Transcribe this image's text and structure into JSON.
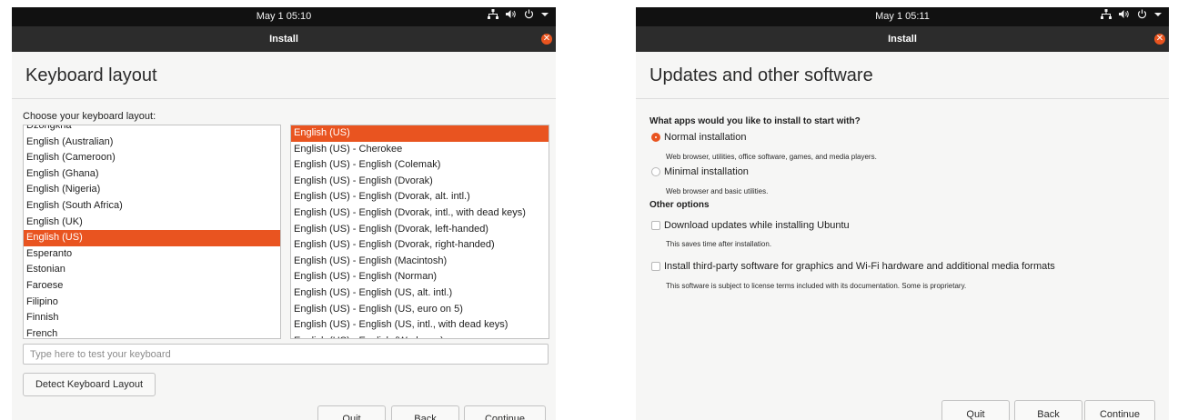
{
  "colors": {
    "accent": "#E95420",
    "topbar": "#111111",
    "titlebar": "#2C2C2C",
    "window_bg": "#F6F6F5"
  },
  "left_window": {
    "clock": "May 1  05:10",
    "tray_icons": [
      "network-icon",
      "volume-icon",
      "power-icon",
      "chevron-down-icon"
    ],
    "window_title": "Install",
    "page_title": "Keyboard layout",
    "prompt": "Choose your keyboard layout:",
    "layouts": [
      "Dzongkha",
      "English (Australian)",
      "English (Cameroon)",
      "English (Ghana)",
      "English (Nigeria)",
      "English (South Africa)",
      "English (UK)",
      "English (US)",
      "Esperanto",
      "Estonian",
      "Faroese",
      "Filipino",
      "Finnish",
      "French"
    ],
    "selected_layout": "English (US)",
    "variants": [
      "English (US)",
      "English (US) - Cherokee",
      "English (US) - English (Colemak)",
      "English (US) - English (Dvorak)",
      "English (US) - English (Dvorak, alt. intl.)",
      "English (US) - English (Dvorak, intl., with dead keys)",
      "English (US) - English (Dvorak, left-handed)",
      "English (US) - English (Dvorak, right-handed)",
      "English (US) - English (Macintosh)",
      "English (US) - English (Norman)",
      "English (US) - English (US, alt. intl.)",
      "English (US) - English (US, euro on 5)",
      "English (US) - English (US, intl., with dead keys)",
      "English (US) - English (Workman)"
    ],
    "selected_variant": "English (US)",
    "test_placeholder": "Type here to test your keyboard",
    "test_value": "",
    "detect_label": "Detect Keyboard Layout",
    "quit_label": "Quit",
    "back_label": "Back",
    "continue_label": "Continue"
  },
  "right_window": {
    "clock": "May 1  05:11",
    "tray_icons": [
      "network-icon",
      "volume-icon",
      "power-icon",
      "chevron-down-icon"
    ],
    "window_title": "Install",
    "page_title": "Updates and other software",
    "question": "What apps would you like to install to start with?",
    "normal_label": "Normal installation",
    "normal_desc": "Web browser, utilities, office software, games, and media players.",
    "normal_selected": true,
    "minimal_label": "Minimal installation",
    "minimal_desc": "Web browser and basic utilities.",
    "minimal_selected": false,
    "other_options_heading": "Other options",
    "updates_label": "Download updates while installing Ubuntu",
    "updates_desc": "This saves time after installation.",
    "updates_checked": false,
    "thirdparty_label": "Install third-party software for graphics and Wi-Fi hardware and additional media formats",
    "thirdparty_desc": "This software is subject to license terms included with its documentation. Some is proprietary.",
    "thirdparty_checked": false,
    "quit_label": "Quit",
    "back_label": "Back",
    "continue_label": "Continue"
  }
}
